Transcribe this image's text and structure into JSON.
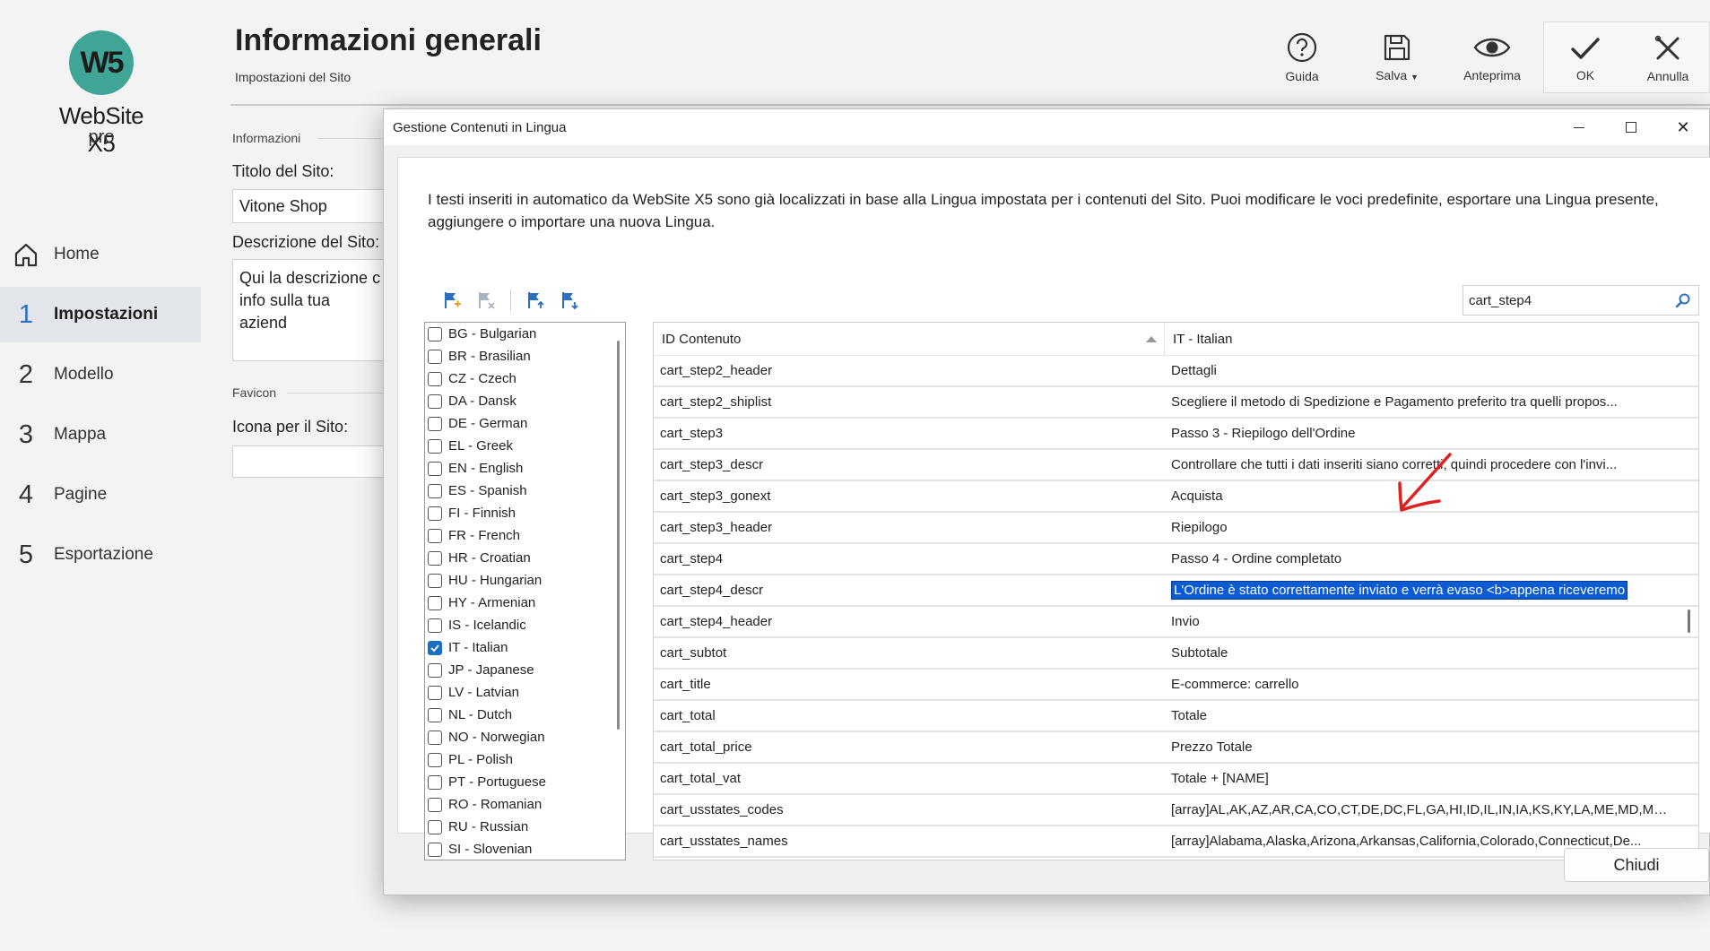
{
  "app": {
    "logo_mark": "W5",
    "logo_name": "WebSite X5",
    "logo_edition": "pro"
  },
  "sidebar": {
    "items": [
      {
        "num": "",
        "label": "Home",
        "icon": "home-icon"
      },
      {
        "num": "1",
        "label": "Impostazioni",
        "active": true
      },
      {
        "num": "2",
        "label": "Modello"
      },
      {
        "num": "3",
        "label": "Mappa"
      },
      {
        "num": "4",
        "label": "Pagine"
      },
      {
        "num": "5",
        "label": "Esportazione"
      }
    ]
  },
  "header": {
    "title": "Informazioni generali",
    "subtitle": "Impostazioni del Sito"
  },
  "toolbar": {
    "help_label": "Guida",
    "save_label": "Salva",
    "preview_label": "Anteprima",
    "ok_label": "OK",
    "cancel_label": "Annulla"
  },
  "form": {
    "section_info": "Informazioni",
    "site_title_label": "Titolo del Sito:",
    "site_title_value": "Vitone Shop",
    "site_desc_label": "Descrizione del Sito:",
    "site_desc_value_line1": "Qui la descrizione c",
    "site_desc_value_line2": "info sulla tua aziend",
    "section_favicon": "Favicon",
    "icon_label": "Icona per il Sito:"
  },
  "dialog": {
    "title": "Gestione Contenuti in Lingua",
    "intro": "I testi inseriti in automatico da WebSite X5 sono già localizzati in base alla Lingua impostata per i contenuti del Sito. Puoi modificare le voci predefinite, esportare una Lingua presente, aggiungere o importare una nuova Lingua.",
    "search_value": "cart_step4",
    "close_label": "Chiudi",
    "languages": [
      {
        "label": "BG - Bulgarian",
        "checked": false
      },
      {
        "label": "BR - Brasilian",
        "checked": false
      },
      {
        "label": "CZ - Czech",
        "checked": false
      },
      {
        "label": "DA - Dansk",
        "checked": false
      },
      {
        "label": "DE - German",
        "checked": false
      },
      {
        "label": "EL - Greek",
        "checked": false
      },
      {
        "label": "EN - English",
        "checked": false
      },
      {
        "label": "ES - Spanish",
        "checked": false
      },
      {
        "label": "FI - Finnish",
        "checked": false
      },
      {
        "label": "FR - French",
        "checked": false
      },
      {
        "label": "HR - Croatian",
        "checked": false
      },
      {
        "label": "HU - Hungarian",
        "checked": false
      },
      {
        "label": "HY - Armenian",
        "checked": false
      },
      {
        "label": "IS - Icelandic",
        "checked": false
      },
      {
        "label": "IT - Italian",
        "checked": true
      },
      {
        "label": "JP - Japanese",
        "checked": false
      },
      {
        "label": "LV - Latvian",
        "checked": false
      },
      {
        "label": "NL - Dutch",
        "checked": false
      },
      {
        "label": "NO - Norwegian",
        "checked": false
      },
      {
        "label": "PL - Polish",
        "checked": false
      },
      {
        "label": "PT - Portuguese",
        "checked": false
      },
      {
        "label": "RO - Romanian",
        "checked": false
      },
      {
        "label": "RU - Russian",
        "checked": false
      },
      {
        "label": "SI - Slovenian",
        "checked": false
      }
    ],
    "table": {
      "col_id": "ID Contenuto",
      "col_lang": "IT - Italian",
      "rows": [
        {
          "id": "cart_step2_header",
          "text": "Dettagli"
        },
        {
          "id": "cart_step2_shiplist",
          "text": "Scegliere il metodo di Spedizione e Pagamento preferito tra quelli propos..."
        },
        {
          "id": "cart_step3",
          "text": "Passo 3 - Riepilogo dell'Ordine"
        },
        {
          "id": "cart_step3_descr",
          "text": "Controllare che tutti i dati inseriti siano corretti, quindi procedere con l'invi..."
        },
        {
          "id": "cart_step3_gonext",
          "text": "Acquista"
        },
        {
          "id": "cart_step3_header",
          "text": "Riepilogo"
        },
        {
          "id": "cart_step4",
          "text": "Passo 4 - Ordine completato"
        },
        {
          "id": "cart_step4_descr",
          "text": "L'Ordine è stato correttamente inviato e verrà evaso <b>appena riceveremo",
          "selected": true
        },
        {
          "id": "cart_step4_header",
          "text": "Invio"
        },
        {
          "id": "cart_subtot",
          "text": "Subtotale"
        },
        {
          "id": "cart_title",
          "text": "E-commerce: carrello"
        },
        {
          "id": "cart_total",
          "text": "Totale"
        },
        {
          "id": "cart_total_price",
          "text": "Prezzo Totale"
        },
        {
          "id": "cart_total_vat",
          "text": "Totale + [NAME]"
        },
        {
          "id": "cart_usstates_codes",
          "text": "[array]AL,AK,AZ,AR,CA,CO,CT,DE,DC,FL,GA,HI,ID,IL,IN,IA,KS,KY,LA,ME,MD,MA..."
        },
        {
          "id": "cart_usstates_names",
          "text": "[array]Alabama,Alaska,Arizona,Arkansas,California,Colorado,Connecticut,De..."
        }
      ]
    }
  },
  "colors": {
    "brand": "#3fa596",
    "accent": "#1a6fc4",
    "selection": "#0a5bd4",
    "annotation": "#e02020"
  }
}
